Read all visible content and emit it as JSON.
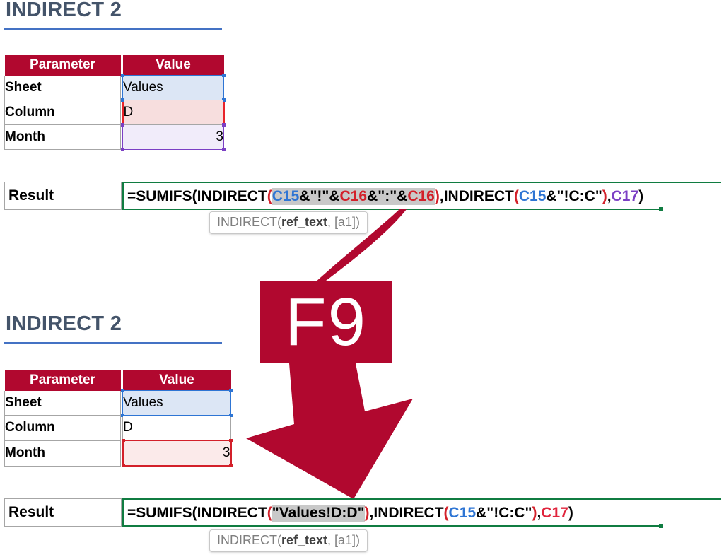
{
  "sections": [
    {
      "title": "INDIRECT 2",
      "table": {
        "headers": [
          "Parameter",
          "Value"
        ],
        "rows": [
          {
            "label": "Sheet",
            "value": "Values",
            "highlight": "blue",
            "align": "left"
          },
          {
            "label": "Column",
            "value": "D",
            "highlight": "red",
            "align": "left"
          },
          {
            "label": "Month",
            "value": "3",
            "highlight": "purple",
            "align": "right"
          }
        ]
      },
      "result": {
        "label": "Result",
        "formula_tokens": [
          {
            "text": "=SUMIFS(INDIRECT",
            "color": "black",
            "highlight": false
          },
          {
            "text": "(",
            "color": "red",
            "highlight": false
          },
          {
            "text": "C15",
            "color": "blue",
            "highlight": true
          },
          {
            "text": "&\"!\"&",
            "color": "black",
            "highlight": true
          },
          {
            "text": "C16",
            "color": "red",
            "highlight": true
          },
          {
            "text": "&\":\"&",
            "color": "black",
            "highlight": true
          },
          {
            "text": "C16",
            "color": "red",
            "highlight": true
          },
          {
            "text": ")",
            "color": "red",
            "highlight": false
          },
          {
            "text": ",INDIRECT",
            "color": "black",
            "highlight": false
          },
          {
            "text": "(",
            "color": "red",
            "highlight": false
          },
          {
            "text": "C15",
            "color": "blue",
            "highlight": false
          },
          {
            "text": "&\"!C:C\"",
            "color": "black",
            "highlight": false
          },
          {
            "text": ")",
            "color": "red",
            "highlight": false
          },
          {
            "text": ",",
            "color": "black",
            "highlight": false
          },
          {
            "text": "C17",
            "color": "purple",
            "highlight": false
          },
          {
            "text": ")",
            "color": "black",
            "highlight": false
          }
        ],
        "formula_plain": "=SUMIFS(INDIRECT(C15&\"!\"&C16&\":\"&C16),INDIRECT(C15&\"!C:C\"),C17)"
      },
      "tooltip": {
        "prefix": "INDIRECT(",
        "bold": "ref_text",
        "suffix": ", [a1])"
      }
    },
    {
      "title": "INDIRECT 2",
      "table": {
        "headers": [
          "Parameter",
          "Value"
        ],
        "rows": [
          {
            "label": "Sheet",
            "value": "Values",
            "highlight": "blue",
            "align": "left"
          },
          {
            "label": "Column",
            "value": "D",
            "highlight": "none",
            "align": "left"
          },
          {
            "label": "Month",
            "value": "3",
            "highlight": "redbox",
            "align": "right"
          }
        ]
      },
      "result": {
        "label": "Result",
        "formula_tokens": [
          {
            "text": "=SUMIFS(INDIRECT",
            "color": "black",
            "highlight": false
          },
          {
            "text": "(",
            "color": "red",
            "highlight": false
          },
          {
            "text": "\"Values!D:D\"",
            "color": "black",
            "highlight": true
          },
          {
            "text": ")",
            "color": "red",
            "highlight": false
          },
          {
            "text": ",INDIRECT",
            "color": "black",
            "highlight": false
          },
          {
            "text": "(",
            "color": "red",
            "highlight": false
          },
          {
            "text": "C15",
            "color": "blue",
            "highlight": false
          },
          {
            "text": "&\"!C:C\"",
            "color": "black",
            "highlight": false
          },
          {
            "text": ")",
            "color": "red",
            "highlight": false
          },
          {
            "text": ",",
            "color": "black",
            "highlight": false
          },
          {
            "text": "C17",
            "color": "crimson",
            "highlight": false
          },
          {
            "text": ")",
            "color": "black",
            "highlight": false
          }
        ],
        "formula_plain": "=SUMIFS(INDIRECT(\"Values!D:D\"),INDIRECT(C15&\"!C:C\"),C17)"
      },
      "tooltip": {
        "prefix": "INDIRECT(",
        "bold": "ref_text",
        "suffix": ", [a1])"
      }
    }
  ],
  "callout": {
    "key_label": "F9",
    "accent_color": "#B1082F",
    "arrow_name": "down-arrow"
  },
  "colors": {
    "header_fill": "#B1082F",
    "title_text": "#44546A",
    "title_rule": "#4472C4",
    "formula_border": "#107C41",
    "blue_ref": "#2E75D4",
    "red_ref": "#D3202A",
    "purple_ref": "#7B3FC4",
    "highlight_gray": "#C9C9C9"
  }
}
